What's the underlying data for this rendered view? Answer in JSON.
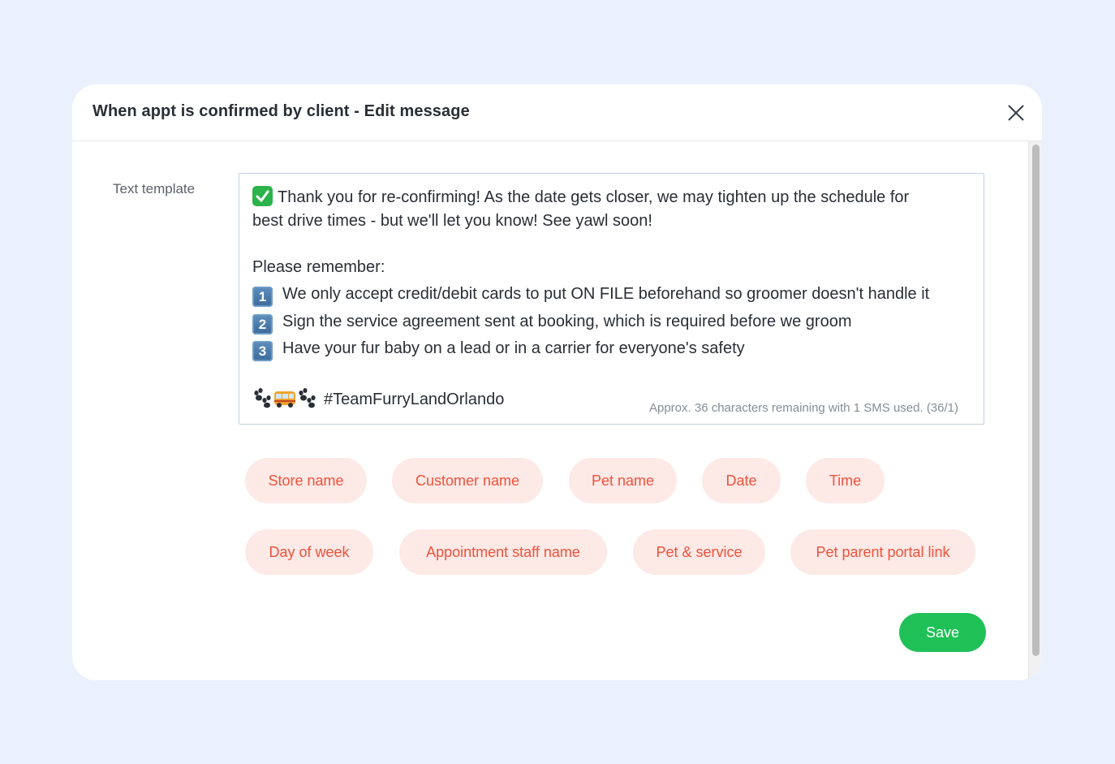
{
  "modal": {
    "title": "When appt is confirmed by client - Edit message",
    "close_icon": "close-icon"
  },
  "form": {
    "label": "Text template",
    "message": {
      "line1": "Thank you for re-confirming!  As the date gets closer, we may tighten up the schedule for",
      "line2": "best drive times - but we'll let you know!  See yawl soon!",
      "line3": "Please remember:",
      "items": [
        {
          "key": "1",
          "text": "We only accept credit/debit cards to put ON FILE beforehand so groomer doesn't handle it"
        },
        {
          "key": "2",
          "text": "Sign the service agreement sent at booking, which is required before we groom"
        },
        {
          "key": "3",
          "text": "Have your fur baby on a lead or in a carrier for everyone's safety"
        }
      ],
      "hashtag": "#TeamFurryLandOrlando",
      "emojis": [
        "check-mark-icon",
        "paw-prints-icon",
        "van-icon",
        "paw-prints-icon"
      ]
    },
    "counter": "Approx. 36 characters remaining with 1 SMS used. (36/1)"
  },
  "chips": [
    {
      "label": "Store name"
    },
    {
      "label": "Customer name"
    },
    {
      "label": "Pet name"
    },
    {
      "label": "Date"
    },
    {
      "label": "Time"
    },
    {
      "label": "Day of week"
    },
    {
      "label": "Appointment staff name"
    },
    {
      "label": "Pet & service"
    },
    {
      "label": "Pet parent portal link"
    }
  ],
  "actions": {
    "save_label": "Save"
  },
  "colors": {
    "background": "#eaf1fd",
    "chip_bg": "#fde9e6",
    "chip_text": "#f0523b",
    "save_bg": "#1fc157"
  }
}
